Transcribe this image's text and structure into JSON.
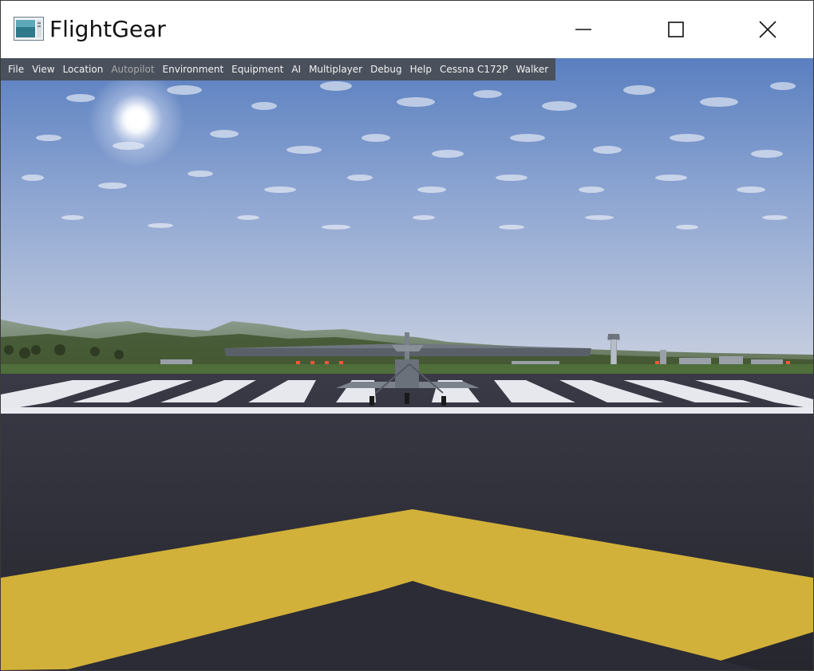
{
  "window": {
    "title": "FlightGear",
    "controls": {
      "minimize": "minimize-icon",
      "maximize": "maximize-icon",
      "close": "close-icon"
    }
  },
  "menubar": {
    "items": [
      {
        "label": "File",
        "enabled": true
      },
      {
        "label": "View",
        "enabled": true
      },
      {
        "label": "Location",
        "enabled": true
      },
      {
        "label": "Autopilot",
        "enabled": false
      },
      {
        "label": "Environment",
        "enabled": true
      },
      {
        "label": "Equipment",
        "enabled": true
      },
      {
        "label": "AI",
        "enabled": true
      },
      {
        "label": "Multiplayer",
        "enabled": true
      },
      {
        "label": "Debug",
        "enabled": true
      },
      {
        "label": "Help",
        "enabled": true
      },
      {
        "label": "Cessna C172P",
        "enabled": true
      },
      {
        "label": "Walker",
        "enabled": true
      }
    ]
  },
  "scene": {
    "description_icons": [
      "sun-icon",
      "aircraft-icon",
      "control-tower-icon"
    ],
    "colors": {
      "sky_top": "#5a7fc0",
      "sky_horizon": "#c4cde0",
      "runway": "#2f2f3a",
      "taxi_marking": "#d2b13a",
      "threshold_stripes": "#e6e8ee"
    }
  }
}
